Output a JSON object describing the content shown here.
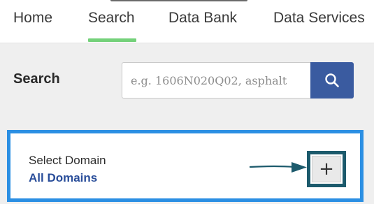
{
  "nav": {
    "tabs": [
      {
        "label": "Home"
      },
      {
        "label": "Search",
        "active": true
      },
      {
        "label": "Data Bank"
      },
      {
        "label": "Data Services"
      }
    ],
    "active_color": "#74d17a"
  },
  "search": {
    "label": "Search",
    "placeholder": "e.g. 1606N020Q02, asphalt",
    "button_icon": "search-icon",
    "button_color": "#3a5ba0"
  },
  "domain": {
    "title": "Select Domain",
    "value": "All Domains",
    "add_symbol": "+",
    "highlight_color": "#2b8fe3",
    "callout_color": "#1c5a6c"
  }
}
